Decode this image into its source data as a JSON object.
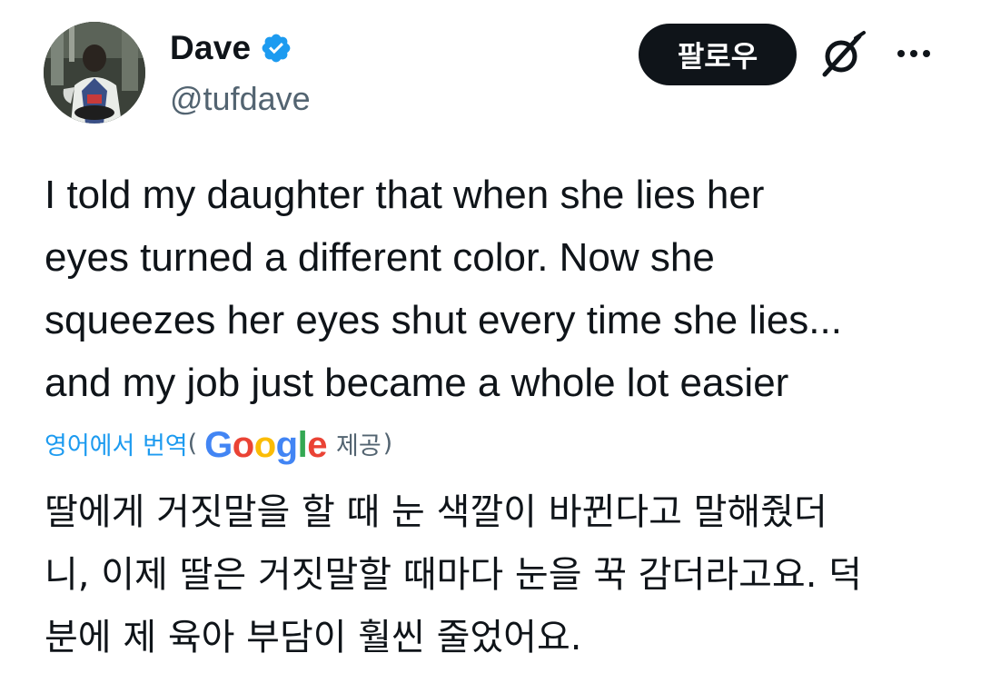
{
  "author": {
    "display_name": "Dave",
    "handle": "@tufdave",
    "verified": true
  },
  "actions": {
    "follow_label": "팔로우",
    "grok_icon": "grok-icon",
    "more_icon": "more-icon"
  },
  "tweet": {
    "text": "I told my daughter that when she lies her\neyes turned a different color. Now she\nsqueezes her eyes shut every time she lies...\nand my job just became a whole lot easier"
  },
  "translation": {
    "link_label": "영어에서 번역",
    "open_paren": "(",
    "provider_letters": [
      "G",
      "o",
      "o",
      "g",
      "l",
      "e"
    ],
    "provided_label": "제공",
    "close_paren": ")",
    "text": "딸에게 거짓말을 할 때 눈 색깔이 바뀐다고 말해줬더\n니, 이제 딸은 거짓말할 때마다 눈을 꾹 감더라고요. 덕\n분에 제 육아 부담이 훨씬 줄었어요."
  },
  "colors": {
    "verified_blue": "#1d9bf0",
    "link_blue": "#1d9bf0",
    "button_bg": "#0f1419",
    "secondary_text": "#536471"
  }
}
